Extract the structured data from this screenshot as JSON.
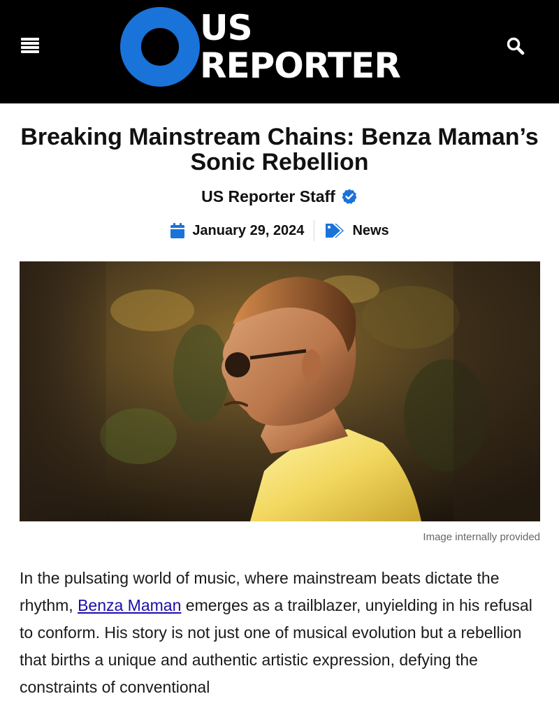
{
  "header": {
    "logo_line1": "US",
    "logo_line2": "REPORTER",
    "logo_ring_color": "#1a73d9",
    "menu_icon": "hamburger-menu-icon",
    "search_icon": "search-icon"
  },
  "article": {
    "title": "Breaking Mainstream Chains: Benza Maman’s Sonic Rebellion",
    "author": "US Reporter Staff",
    "verified_icon": "verified-badge-icon",
    "date": "January 29, 2024",
    "date_icon": "calendar-icon",
    "category": "News",
    "category_icon": "tags-icon",
    "accent_color": "#1a73d9",
    "image_caption": "Image internally provided",
    "body_before_link": "In the pulsating world of music, where mainstream beats dictate the rhythm, ",
    "body_link_text": "Benza Maman",
    "body_after_link": " emerges as a trailblazer, unyielding in his refusal to conform. His story is not just one of musical evolution but a rebellion that births a unique and authentic artistic expression, defying the constraints of conventional"
  }
}
